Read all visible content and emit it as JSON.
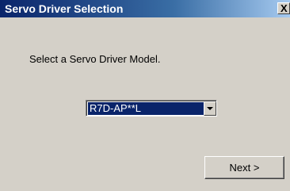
{
  "window": {
    "title": "Servo Driver Selection",
    "close_label": "X"
  },
  "dialog": {
    "prompt": "Select a Servo Driver Model.",
    "model_select": {
      "selected_value": "R7D-AP**L"
    },
    "next_label": "Next >"
  },
  "colors": {
    "titlebar_start": "#0a246a",
    "titlebar_end": "#a6caf0",
    "dialog_background": "#d4d0c8",
    "selection_highlight": "#0a246a"
  },
  "icons": {
    "dropdown": "chevron-down-icon",
    "close": "close-icon"
  }
}
